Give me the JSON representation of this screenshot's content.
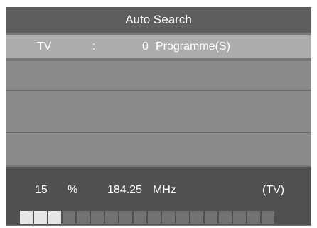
{
  "title": "Auto Search",
  "channel_row": {
    "type": "TV",
    "separator": ":",
    "count": "0",
    "unit": "Programme(S)"
  },
  "status": {
    "percent": "15",
    "percent_sign": "%",
    "frequency": "184.25",
    "freq_unit": "MHz",
    "mode": "(TV)"
  },
  "progress": {
    "total_segments": 18,
    "filled_segments": 3,
    "fraction": 0.15
  }
}
